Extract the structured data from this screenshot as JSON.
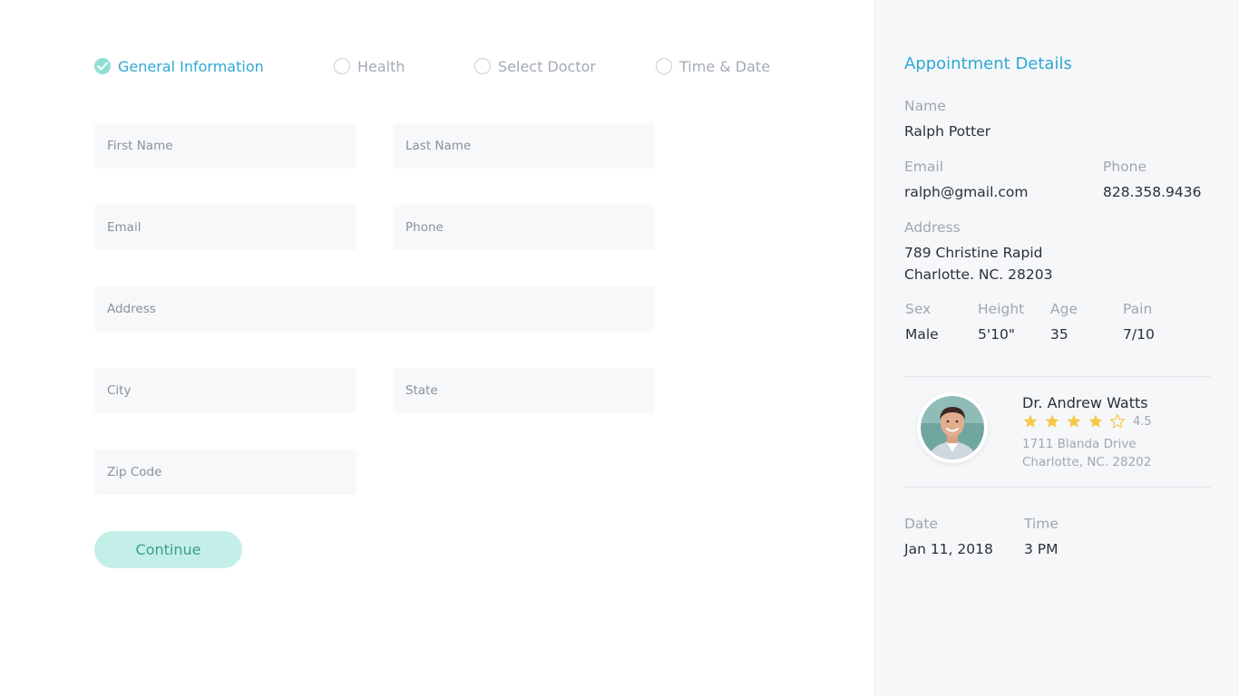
{
  "steps": [
    {
      "label": "General Information",
      "state": "completed"
    },
    {
      "label": "Health",
      "state": "pending"
    },
    {
      "label": "Select Doctor",
      "state": "pending"
    },
    {
      "label": "Time & Date",
      "state": "pending"
    }
  ],
  "form": {
    "first_name_placeholder": "First Name",
    "last_name_placeholder": "Last Name",
    "email_placeholder": "Email",
    "phone_placeholder": "Phone",
    "address_placeholder": "Address",
    "city_placeholder": "City",
    "state_placeholder": "State",
    "zip_placeholder": "Zip Code",
    "continue_label": "Continue"
  },
  "details": {
    "title": "Appointment Details",
    "name_label": "Name",
    "name_value": "Ralph Potter",
    "email_label": "Email",
    "email_value": "ralph@gmail.com",
    "phone_label": "Phone",
    "phone_value": "828.358.9436",
    "address_label": "Address",
    "address_line1": "789 Christine Rapid",
    "address_line2": "Charlotte. NC. 28203",
    "sex_label": "Sex",
    "sex_value": "Male",
    "height_label": "Height",
    "height_value": "5'10\"",
    "age_label": "Age",
    "age_value": "35",
    "pain_label": "Pain",
    "pain_value": "7/10",
    "date_label": "Date",
    "date_value": "Jan 11, 2018",
    "time_label": "Time",
    "time_value": "3 PM"
  },
  "doctor": {
    "name": "Dr. Andrew Watts",
    "rating": 4.5,
    "rating_text": "4.5",
    "address_line1": "1711 Blanda Drive",
    "address_line2": "Charlotte, NC. 28202",
    "avatar_icon": "doctor-avatar"
  },
  "colors": {
    "accent": "#2fa8d4",
    "teal": "#8fdfd5",
    "star": "#f7c948",
    "button_bg": "#c4efe9",
    "button_text": "#3c9c92"
  }
}
